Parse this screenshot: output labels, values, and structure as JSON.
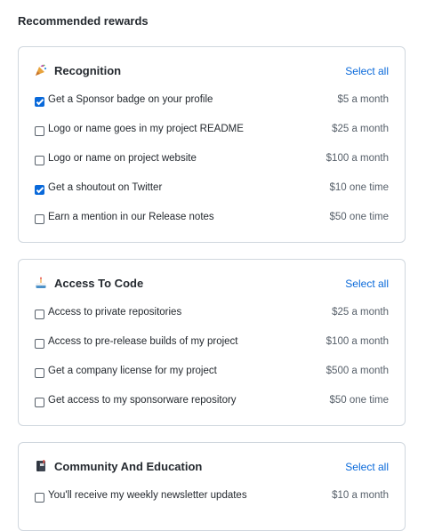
{
  "page": {
    "heading": "Recommended rewards"
  },
  "sections": [
    {
      "title": "Recognition",
      "icon": "party-popper-icon",
      "select_all": "Select all",
      "items": [
        {
          "label": "Get a Sponsor badge on your profile",
          "price": "$5 a month",
          "checked": true
        },
        {
          "label": "Logo or name goes in my project README",
          "price": "$25 a month",
          "checked": false
        },
        {
          "label": "Logo or name on project website",
          "price": "$100 a month",
          "checked": false
        },
        {
          "label": "Get a shoutout on Twitter",
          "price": "$10 one time",
          "checked": true
        },
        {
          "label": "Earn a mention in our Release notes",
          "price": "$50 one time",
          "checked": false
        }
      ]
    },
    {
      "title": "Access To Code",
      "icon": "cake-icon",
      "select_all": "Select all",
      "items": [
        {
          "label": "Access to private repositories",
          "price": "$25 a month",
          "checked": false
        },
        {
          "label": "Access to pre-release builds of my project",
          "price": "$100 a month",
          "checked": false
        },
        {
          "label": "Get a company license for my project",
          "price": "$500 a month",
          "checked": false
        },
        {
          "label": "Get access to my sponsorware repository",
          "price": "$50 one time",
          "checked": false
        }
      ]
    },
    {
      "title": "Community And Education",
      "icon": "notebook-icon",
      "select_all": "Select all",
      "items": [
        {
          "label": "You'll receive my weekly newsletter updates",
          "price": "$10 a month",
          "checked": false
        }
      ]
    }
  ]
}
